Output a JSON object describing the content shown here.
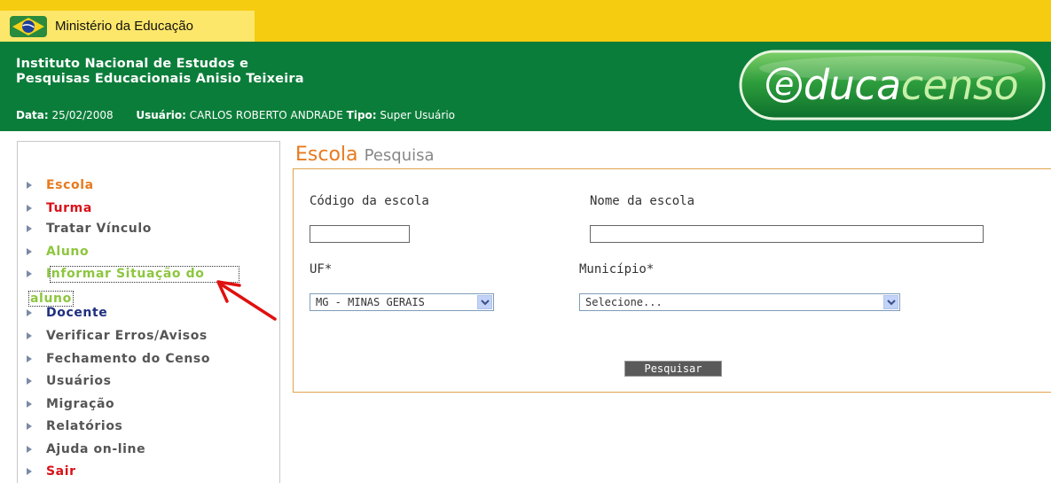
{
  "top_bar": {
    "ministry_label": "Ministério da Educação"
  },
  "header": {
    "institute_line1": "Instituto Nacional de Estudos e",
    "institute_line2": "Pesquisas Educacionais Anisio Teixeira",
    "date_label": "Data:",
    "date_value": "25/02/2008",
    "user_label": "Usuário:",
    "user_value": "CARLOS ROBERTO ANDRADE",
    "type_label": "Tipo:",
    "type_value": "Super Usuário",
    "logo_text_e": "e",
    "logo_text_rest": "duca",
    "logo_text_censo": "censo"
  },
  "sidebar": {
    "items": [
      {
        "label": "Escola"
      },
      {
        "label": "Turma"
      },
      {
        "label": "Tratar Vínculo"
      },
      {
        "label": "Aluno"
      },
      {
        "label": "Informar Situação do"
      },
      {
        "label": "Docente"
      },
      {
        "label": "Verificar Erros/Avisos"
      },
      {
        "label": "Fechamento do Censo"
      },
      {
        "label": "Usuários"
      },
      {
        "label": "Migração"
      },
      {
        "label": "Relatórios"
      },
      {
        "label": "Ajuda on-line"
      },
      {
        "label": "Sair"
      }
    ],
    "situacao_continuation": "aluno"
  },
  "page": {
    "title": "Escola",
    "subtitle": "Pesquisa"
  },
  "form": {
    "codigo_label": "Código da escola",
    "codigo_value": "",
    "nome_label": "Nome da escola",
    "nome_value": "",
    "uf_label": "UF*",
    "uf_selected": "MG - MINAS GERAIS",
    "municipio_label": "Município*",
    "municipio_selected": "Selecione...",
    "search_button": "Pesquisar"
  },
  "colors": {
    "yellow_bar": "#f6cc11",
    "green_header": "#0b7d3a",
    "orange": "#e87a1e",
    "red": "#d8121a",
    "green_link": "#8dc63f",
    "navy": "#1f2f7f"
  }
}
